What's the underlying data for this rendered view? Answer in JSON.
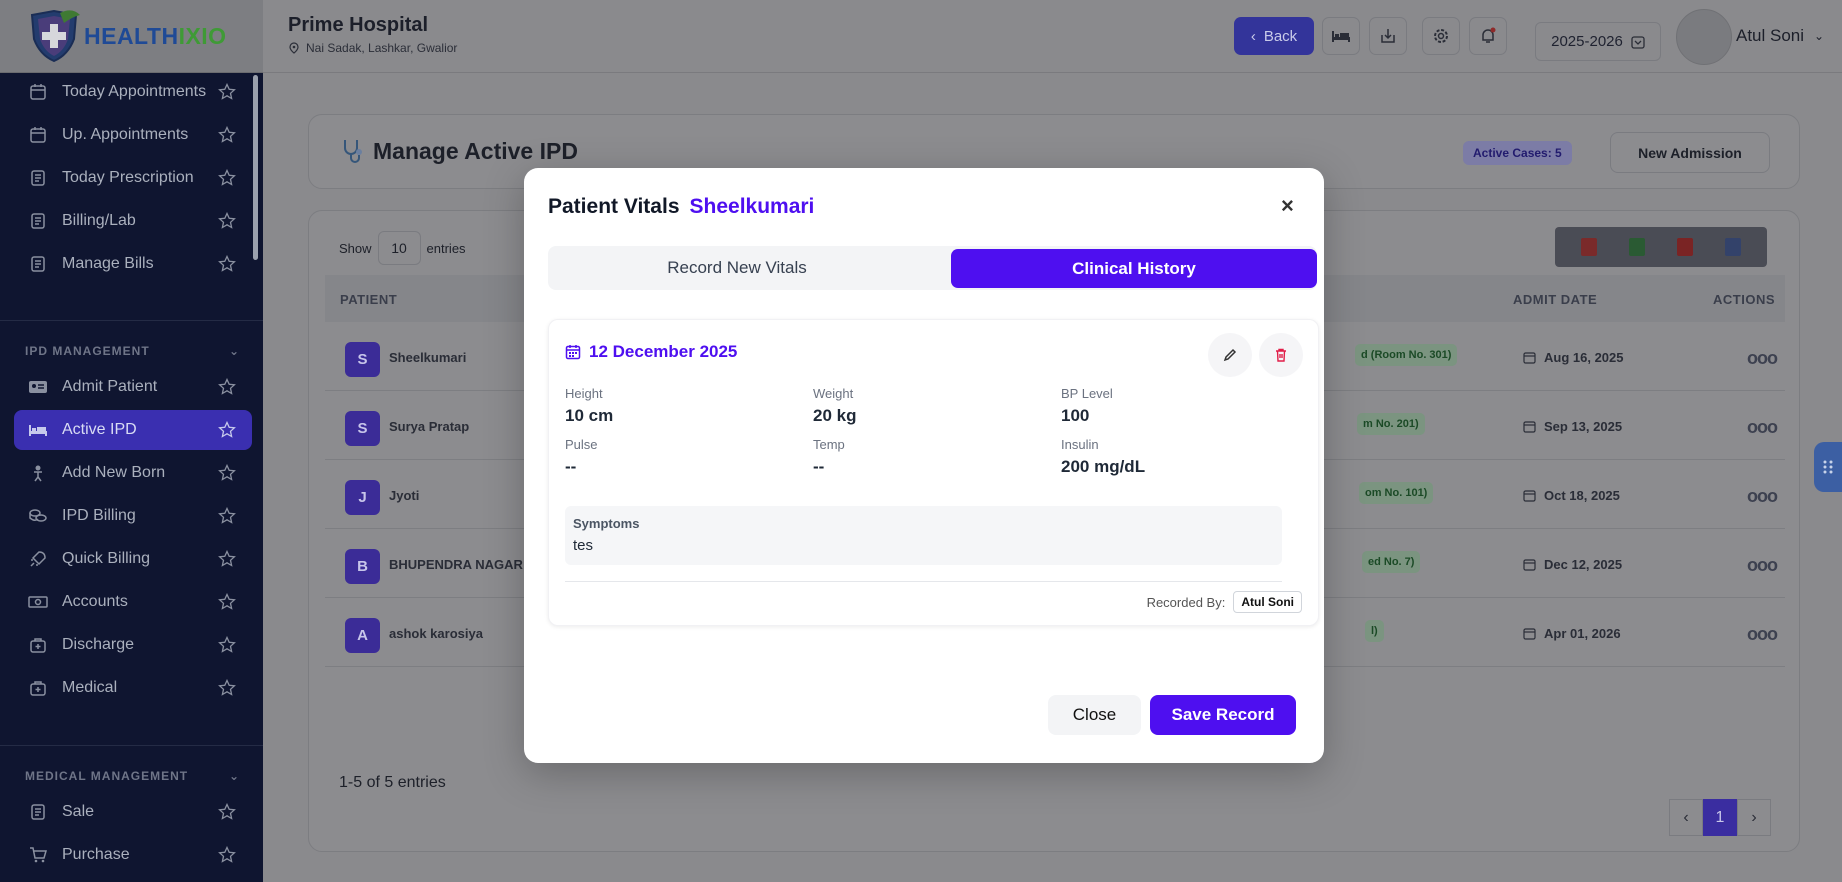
{
  "brand": {
    "logo_part1": "HEALTH",
    "logo_part2": "IXIO"
  },
  "header": {
    "hospital_name": "Prime Hospital",
    "hospital_address": "Nai Sadak, Lashkar, Gwalior",
    "back_label": "Back",
    "year": "2025-2026",
    "user_name": "Atul Soni"
  },
  "sidebar": {
    "items_top": [
      {
        "label": "Today Appointments",
        "icon": "calendar-icon"
      },
      {
        "label": "Up. Appointments",
        "icon": "calendar-icon"
      },
      {
        "label": "Today Prescription",
        "icon": "document-icon"
      },
      {
        "label": "Billing/Lab",
        "icon": "document-icon"
      },
      {
        "label": "Manage Bills",
        "icon": "document-icon"
      }
    ],
    "section_ipd": "IPD MANAGEMENT",
    "items_ipd": [
      {
        "label": "Admit Patient",
        "icon": "id-card-icon"
      },
      {
        "label": "Active IPD",
        "icon": "bed-icon"
      },
      {
        "label": "Add New Born",
        "icon": "baby-icon"
      },
      {
        "label": "IPD Billing",
        "icon": "coins-icon"
      },
      {
        "label": "Quick Billing",
        "icon": "rocket-icon"
      },
      {
        "label": "Accounts",
        "icon": "money-icon"
      },
      {
        "label": "Discharge",
        "icon": "medkit-icon"
      },
      {
        "label": "Medical",
        "icon": "medkit-icon"
      }
    ],
    "section_medical": "MEDICAL MANAGEMENT",
    "items_medical": [
      {
        "label": "Sale",
        "icon": "document-icon"
      },
      {
        "label": "Purchase",
        "icon": "cart-icon"
      }
    ]
  },
  "main": {
    "title": "Manage Active IPD",
    "active_cases": "Active Cases: 5",
    "new_admission": "New Admission",
    "show_label": "Show",
    "entries_value": "10",
    "entries_label": "entries",
    "columns": {
      "patient": "PATIENT",
      "admit_date": "ADMIT DATE",
      "actions": "ACTIONS"
    },
    "rows": [
      {
        "initial": "S",
        "name": "Sheelkumari",
        "room": "d (Room No. 301)",
        "date": "Aug 16, 2025"
      },
      {
        "initial": "S",
        "name": "Surya Pratap",
        "room": "m No. 201)",
        "date": "Sep 13, 2025"
      },
      {
        "initial": "J",
        "name": "Jyoti",
        "room": "om No. 101)",
        "date": "Oct 18, 2025"
      },
      {
        "initial": "B",
        "name": "BHUPENDRA NAGAR",
        "room": "ed No. 7)",
        "date": "Dec 12, 2025"
      },
      {
        "initial": "A",
        "name": "ashok karosiya",
        "room": "l)",
        "date": "Apr 01, 2026"
      }
    ],
    "pager_info": "1-5 of 5 entries",
    "page_current": "1"
  },
  "modal": {
    "title": "Patient Vitals",
    "patient": "Sheelkumari",
    "tab_record": "Record New Vitals",
    "tab_history": "Clinical History",
    "record": {
      "date": "12 December 2025",
      "height_label": "Height",
      "height": "10 cm",
      "weight_label": "Weight",
      "weight": "20 kg",
      "bp_label": "BP Level",
      "bp": "100",
      "pulse_label": "Pulse",
      "pulse": "--",
      "temp_label": "Temp",
      "temp": "--",
      "insulin_label": "Insulin",
      "insulin": "200 mg/dL",
      "symptoms_label": "Symptoms",
      "symptoms": "tes",
      "recorded_by_label": "Recorded By:",
      "recorded_by": "Atul Soni"
    },
    "close_label": "Close",
    "save_label": "Save Record"
  },
  "colors": {
    "accent": "#4e0ff0",
    "sidebar_bg": "#0f1530",
    "delete": "#e11d48"
  }
}
